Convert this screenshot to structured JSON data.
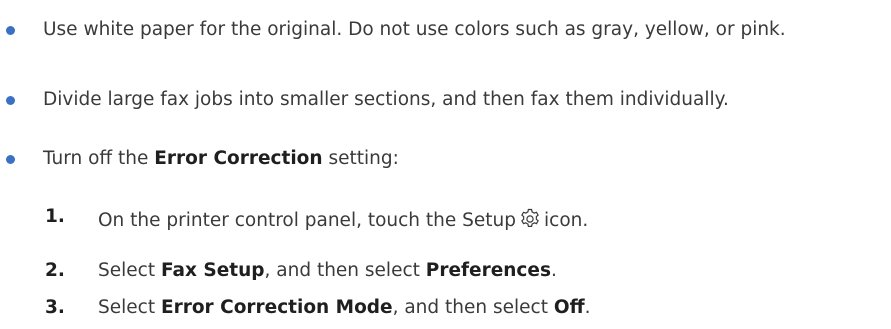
{
  "bullets": [
    {
      "text": "Use white paper for the original. Do not use colors such as gray, yellow, or pink."
    },
    {
      "text": "Divide large fax jobs into smaller sections, and then fax them individually."
    },
    {
      "before": "Turn off the ",
      "bold": "Error Correction",
      "after": " setting:"
    }
  ],
  "steps": [
    {
      "num": "1.",
      "before": "On the printer control panel, touch the Setup",
      "icon": "gear-icon",
      "after": "icon."
    },
    {
      "num": "2.",
      "t1": "Select ",
      "b1": "Fax Setup",
      "t2": ", and then select ",
      "b2": "Preferences",
      "t3": "."
    },
    {
      "num": "3.",
      "t1": "Select ",
      "b1": "Error Correction Mode",
      "t2": ", and then select ",
      "b2": "Off",
      "t3": "."
    }
  ],
  "colors": {
    "bullet": "#3a71c4",
    "text": "#3a3a3a"
  }
}
